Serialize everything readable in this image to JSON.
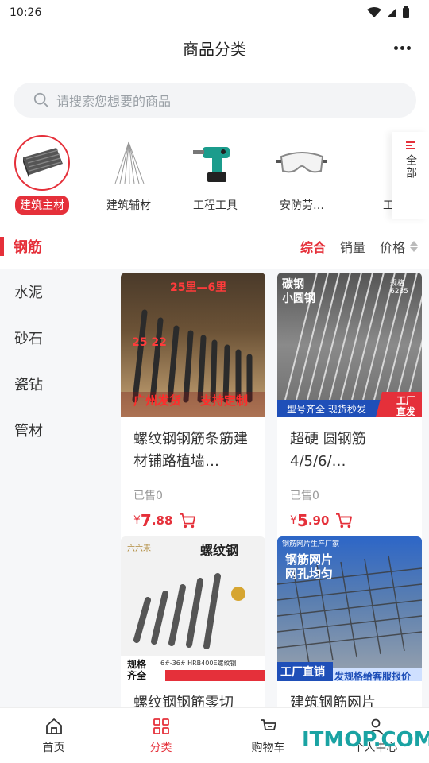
{
  "status": {
    "time": "10:26"
  },
  "header": {
    "title": "商品分类"
  },
  "search": {
    "placeholder": "请搜索您想要的商品"
  },
  "categories": [
    {
      "label": "建筑主材",
      "icon": "rebar-bundle-icon",
      "selected": true
    },
    {
      "label": "建筑辅材",
      "icon": "wire-bundle-icon",
      "selected": false
    },
    {
      "label": "工程工具",
      "icon": "power-drill-icon",
      "selected": false
    },
    {
      "label": "安防劳…",
      "icon": "safety-goggles-icon",
      "selected": false
    },
    {
      "label": "工",
      "icon": "partial-category-icon",
      "selected": false
    }
  ],
  "all_button": {
    "label": "全部"
  },
  "section": {
    "title": "钢筋"
  },
  "sort": {
    "comprehensive": "综合",
    "sales": "销量",
    "price": "价格"
  },
  "sidebar": {
    "items": [
      "水泥",
      "砂石",
      "瓷钻",
      "管材"
    ]
  },
  "products": [
    {
      "name": "螺纹钢钢筋条筋建材铺路植墙…",
      "sold": "已售0",
      "currency": "¥",
      "price_int": "7",
      "price_dec": ".88",
      "img_text": {
        "top": "25里—6里",
        "nums": "25 22",
        "left": "广州发货",
        "right": "支持定制"
      }
    },
    {
      "name": "超硬 圆钢筋4/5/6/…",
      "sold": "已售0",
      "currency": "¥",
      "price_int": "5",
      "price_dec": ".90",
      "img_text": {
        "top1": "碳钢",
        "top2": "小圆钢",
        "spec": "规格6235",
        "strip": "型号齐全 现货秒发",
        "badge1": "工厂",
        "badge2": "直发"
      }
    },
    {
      "name": "螺纹钢钢筋零切",
      "img_text": {
        "brand": "六六来",
        "title": "螺纹钢",
        "spec1": "规格",
        "spec2": "齐全",
        "grade": "6#-36# HRB400E螺纹钢"
      }
    },
    {
      "name": "建筑钢筋网片",
      "img_text": {
        "top": "钢筋网片生产厂家",
        "t1": "钢筋网片",
        "t2": "网孔均匀",
        "b1": "工厂直销",
        "b2": "发规格给客服报价"
      }
    }
  ],
  "tabbar": [
    {
      "label": "首页",
      "icon": "home-icon",
      "active": false
    },
    {
      "label": "分类",
      "icon": "category-grid-icon",
      "active": true
    },
    {
      "label": "购物车",
      "icon": "cart-icon",
      "active": false
    },
    {
      "label": "个人中心",
      "icon": "person-icon",
      "active": false
    }
  ],
  "watermark": "ITMOP.COM",
  "colors": {
    "accent": "#e5303a",
    "bg_gray": "#f6f7f9"
  }
}
